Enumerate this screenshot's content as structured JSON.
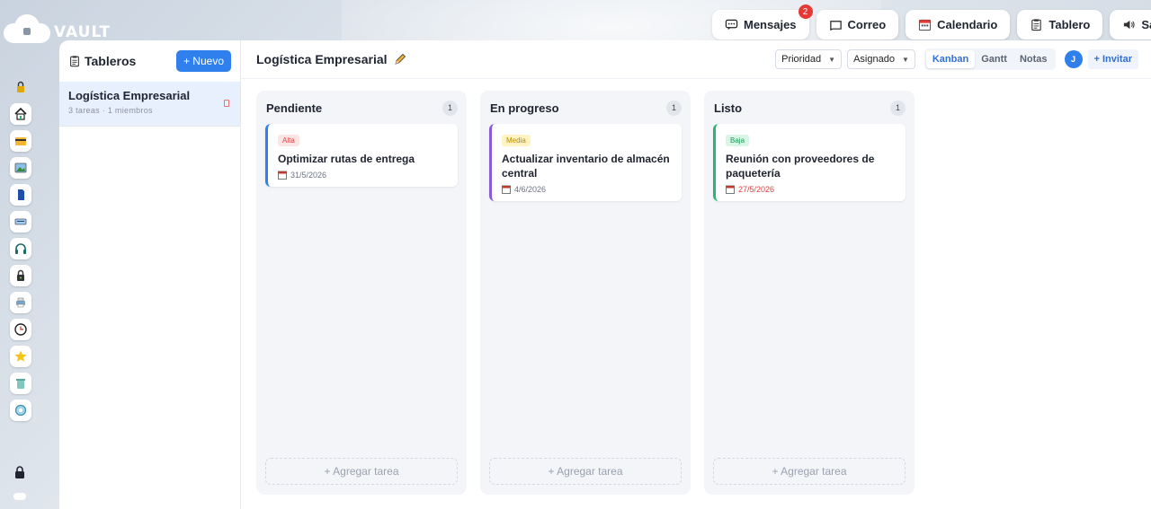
{
  "app": {
    "name": "VAULT"
  },
  "topnav": [
    {
      "id": "mensajes",
      "label": "Mensajes",
      "icon": "chat-icon",
      "badge": "2"
    },
    {
      "id": "correo",
      "label": "Correo",
      "icon": "mail-icon"
    },
    {
      "id": "calendario",
      "label": "Calendario",
      "icon": "calendar-icon"
    },
    {
      "id": "tablero",
      "label": "Tablero",
      "icon": "clipboard-icon"
    },
    {
      "id": "sala",
      "label": "Sala",
      "icon": "speaker-icon"
    }
  ],
  "rail": {
    "items": [
      "lock-icon",
      "home-icon",
      "folder-icon",
      "image-icon",
      "document-icon",
      "keyboard-icon",
      "headphones-icon",
      "locked-file-icon",
      "printer-icon",
      "clock-icon",
      "star-icon",
      "trash-icon",
      "settings-icon"
    ],
    "bottom": [
      "padlock-icon"
    ]
  },
  "sidebar": {
    "title": "Tableros",
    "new_label": "+ Nuevo",
    "boards": [
      {
        "name": "Logística Empresarial",
        "meta": "3 tareas · 1 miembros"
      }
    ]
  },
  "board": {
    "title": "Logística Empresarial",
    "filters": {
      "priority": "Prioridad",
      "assigned": "Asignado"
    },
    "views": [
      "Kanban",
      "Gantt",
      "Notas"
    ],
    "active_view": "Kanban",
    "avatar": "J",
    "invite_label": "+ Invitar",
    "columns": [
      {
        "title": "Pendiente",
        "count": "1",
        "cards": [
          {
            "priority": "Alta",
            "title": "Optimizar rutas de entrega",
            "date": "31/5/2026"
          }
        ],
        "add_label": "+ Agregar tarea"
      },
      {
        "title": "En progreso",
        "count": "1",
        "cards": [
          {
            "priority": "Media",
            "title": "Actualizar inventario de almacén central",
            "date": "4/6/2026"
          }
        ],
        "add_label": "+ Agregar tarea"
      },
      {
        "title": "Listo",
        "count": "1",
        "cards": [
          {
            "priority": "Baja",
            "title": "Reunión con proveedores de paquetería",
            "date": "27/5/2026"
          }
        ],
        "add_label": "+ Agregar tarea"
      }
    ]
  },
  "colors": {
    "accent": "#2f80ed",
    "alta": "#d64545",
    "media": "#b88a00",
    "baja": "#1f9a5a",
    "badge": "#e53935"
  }
}
